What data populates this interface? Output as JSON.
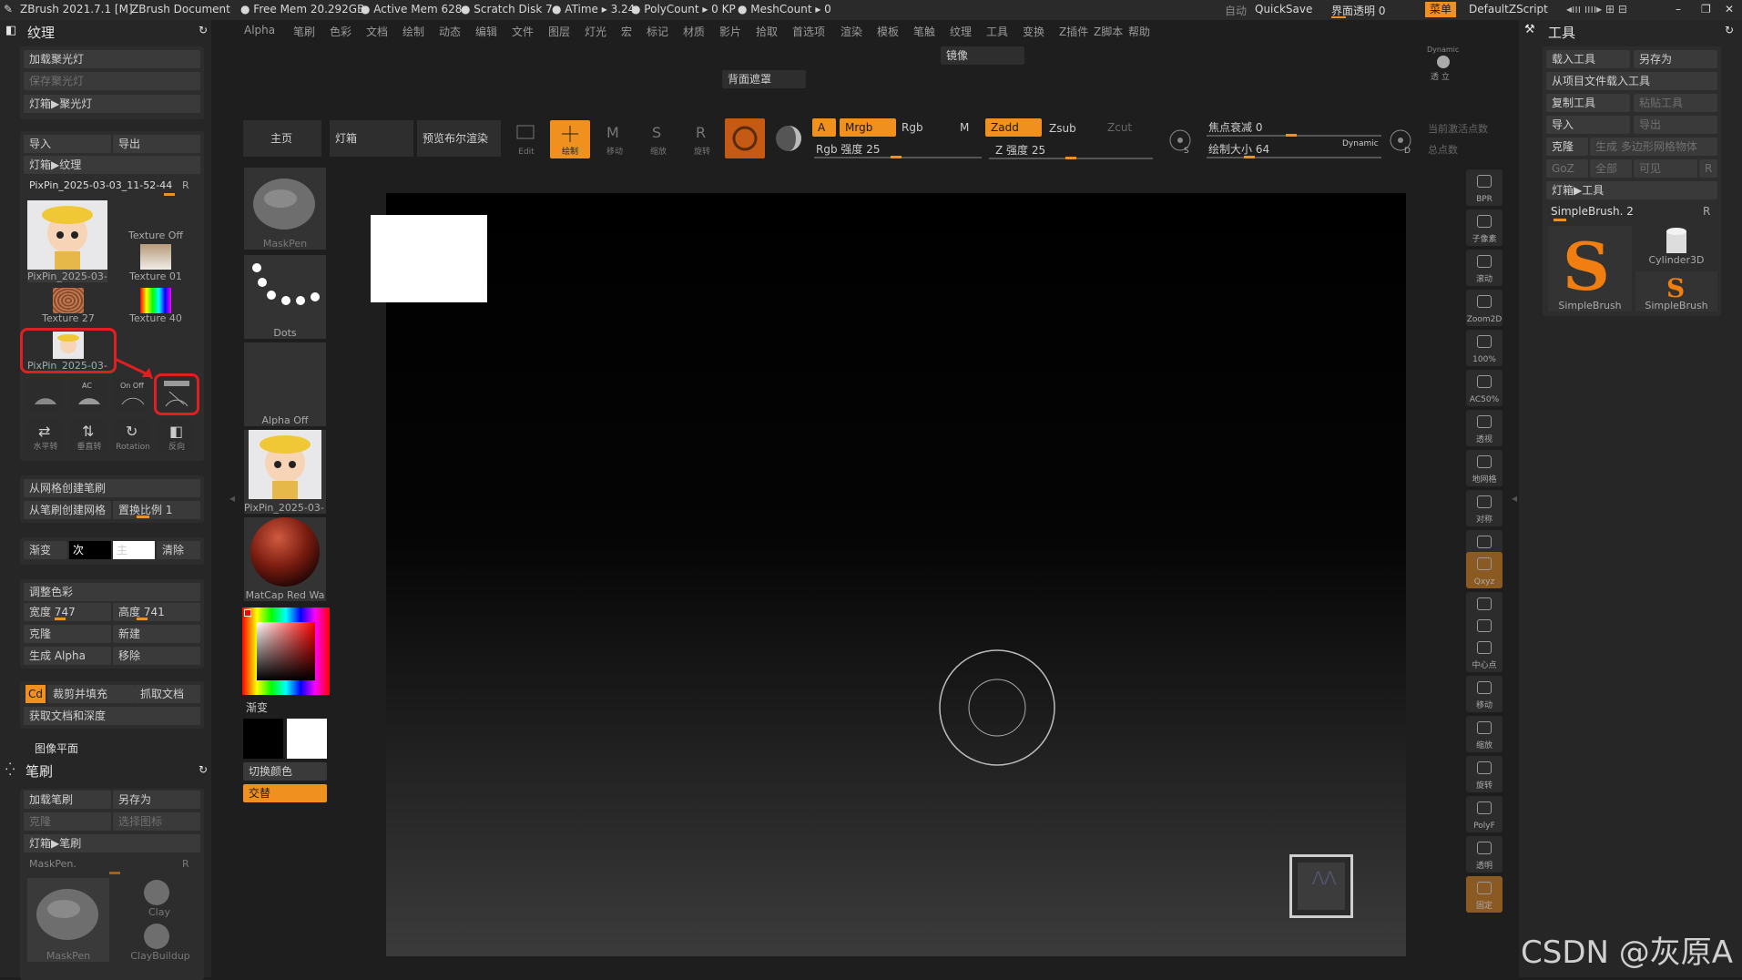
{
  "titlebar": {
    "app": "ZBrush 2021.7.1 [M]",
    "doc": "ZBrush Document",
    "free_mem": "Free Mem 20.292GB",
    "active_mem": "Active Mem 628",
    "scratch": "Scratch Disk 7",
    "atime": "ATime ▸ 3.24",
    "polycount": "PolyCount ▸ 0 KP",
    "meshcount": "MeshCount ▸ 0",
    "auto": "自动",
    "quicksave": "QuickSave",
    "transparency": "界面透明 0",
    "menu": "菜单",
    "script": "DefaultZScript"
  },
  "menubar": [
    "Alpha",
    "笔刷",
    "色彩",
    "文档",
    "绘制",
    "动态",
    "编辑",
    "文件",
    "图层",
    "灯光",
    "宏",
    "标记",
    "材质",
    "影片",
    "拾取",
    "首选项",
    "渲染",
    "模板",
    "笔触",
    "纹理",
    "工具",
    "变换",
    "Z插件",
    "Z脚本",
    "帮助"
  ],
  "subbar": {
    "mirror": "镜像",
    "backface": "背面遮罩"
  },
  "left": {
    "texture_title": "纹理",
    "load_spotlight": "加载聚光灯",
    "save_spotlight": "保存聚光灯",
    "lightbox_spotlight": "灯箱▶聚光灯",
    "import": "导入",
    "export": "导出",
    "lightbox_texture": "灯箱▶纹理",
    "current_texture": "PixPin_2025-03-03_11-52-44",
    "r": "R",
    "tex_tiles": [
      "PixPin_2025-03-",
      "Texture Off",
      "Texture 01",
      "Texture 27",
      "Texture 40",
      "PixPin_2025-03-"
    ],
    "icon_labels": [
      "",
      "AC",
      "On Off",
      "",
      "水平转",
      "垂直转",
      "Rotation",
      "反向"
    ],
    "mesh_brush": "从网格创建笔刷",
    "brush_mesh": "从笔刷创建网格",
    "displace": "置换比例 1",
    "gradient": "渐变",
    "secondary": "次",
    "main": "主",
    "clear": "清除",
    "adjust_color": "调整色彩",
    "width": "宽度 747",
    "height": "高度 741",
    "clone": "克隆",
    "new": "新建",
    "make_alpha": "生成 Alpha",
    "remove": "移除",
    "cd": "Cd",
    "crop_fill": "裁剪并填充",
    "grab_doc": "抓取文档",
    "get_doc_depth": "获取文档和深度",
    "image_plane": "图像平面",
    "brush_title": "笔刷",
    "load_brush": "加载笔刷",
    "save_as": "另存为",
    "clone2": "克隆",
    "select_icon": "选择图标",
    "lightbox_brush": "灯箱▶笔刷",
    "maskpen": "MaskPen.",
    "brush_tiles": [
      "MaskPen",
      "Clay",
      "ClayBuildup"
    ]
  },
  "shelf": {
    "home": "主页",
    "lightbox": "灯箱",
    "preview_render": "预览布尔渲染",
    "tiles": [
      "MaskPen",
      "Dots",
      "Alpha Off",
      "PixPin_2025-03-",
      "MatCap Red Wa"
    ],
    "gradient": "渐变",
    "switch_color": "切换颜色",
    "alternate": "交替"
  },
  "toolbar": {
    "edit": "Edit",
    "draw": "绘制",
    "move": "移动",
    "scale": "缩放",
    "rotate": "旋转",
    "a": "A",
    "mrgb": "Mrgb",
    "rgb": "Rgb",
    "m": "M",
    "rgb_intensity": "Rgb 强度 25",
    "zadd": "Zadd",
    "zsub": "Zsub",
    "zcut": "Zcut",
    "z_intensity": "Z 强度 25",
    "focal": "焦点衰减 0",
    "draw_size": "绘制大小 64",
    "dynamic": "Dynamic",
    "active_points": "当前激活点数",
    "total_points": "总点数"
  },
  "rightstrip": [
    "BPR",
    "子像素",
    "滚动",
    "Zoom2D",
    "100%",
    "AC50%",
    "透视",
    "地网格",
    "对称",
    "",
    "Qxyz",
    "",
    "",
    "中心点",
    "移动",
    "缩放",
    "旋转",
    "PolyF",
    "透明",
    "固定"
  ],
  "right": {
    "tool_title": "工具",
    "load_tool": "载入工具",
    "save_as": "另存为",
    "load_project": "从项目文件载入工具",
    "copy_tool": "复制工具",
    "paste_tool": "粘贴工具",
    "import": "导入",
    "export": "导出",
    "clone": "克隆",
    "make_polymesh": "生成 多边形网格物体",
    "goz": "GoZ",
    "all": "全部",
    "visible": "可见",
    "r": "R",
    "lightbox_tool": "灯箱▶工具",
    "current_tool": "SimpleBrush. 2",
    "tiles": [
      "SimpleBrush",
      "Cylinder3D",
      "SimpleBrush"
    ]
  },
  "dynamic_label": "Dynamic",
  "dynamic_sub": "透 立",
  "watermark": "CSDN @灰原A"
}
